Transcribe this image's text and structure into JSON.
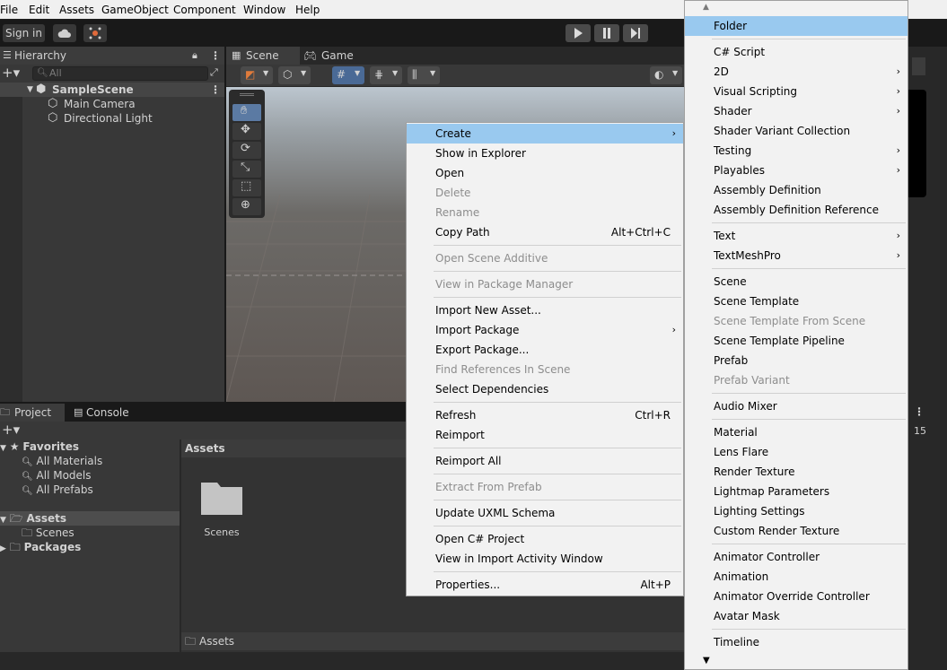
{
  "menubar": {
    "items": [
      "File",
      "Edit",
      "Assets",
      "GameObject",
      "Component",
      "Window",
      "Help"
    ]
  },
  "toolbar": {
    "sign_in": "Sign in"
  },
  "hierarchy": {
    "tab_label": "Hierarchy",
    "search_placeholder": "All",
    "scene_name": "SampleScene",
    "objects": [
      "Main Camera",
      "Directional Light"
    ]
  },
  "scene_view": {
    "tabs": [
      "Scene",
      "Game"
    ]
  },
  "project": {
    "tabs": [
      "Project",
      "Console"
    ],
    "favorites_label": "Favorites",
    "favorites": [
      "All Materials",
      "All Models",
      "All Prefabs"
    ],
    "assets_label": "Assets",
    "assets_children": [
      "Scenes"
    ],
    "packages_label": "Packages",
    "grid_header": "Assets",
    "grid_items": [
      "Scenes"
    ],
    "status_path": "Assets",
    "count_badge": "15"
  },
  "context_menu": {
    "items": [
      {
        "label": "Create",
        "submenu": true,
        "highlighted": true
      },
      {
        "label": "Show in Explorer"
      },
      {
        "label": "Open"
      },
      {
        "label": "Delete",
        "disabled": true
      },
      {
        "label": "Rename",
        "disabled": true
      },
      {
        "label": "Copy Path",
        "shortcut": "Alt+Ctrl+C"
      },
      {
        "label": "Open Scene Additive",
        "disabled": true
      },
      {
        "label": "View in Package Manager",
        "disabled": true
      },
      {
        "label": "Import New Asset..."
      },
      {
        "label": "Import Package",
        "submenu": true
      },
      {
        "label": "Export Package..."
      },
      {
        "label": "Find References In Scene",
        "disabled": true
      },
      {
        "label": "Select Dependencies"
      },
      {
        "label": "Refresh",
        "shortcut": "Ctrl+R"
      },
      {
        "label": "Reimport"
      },
      {
        "label": "Reimport All"
      },
      {
        "label": "Extract From Prefab",
        "disabled": true
      },
      {
        "label": "Update UXML Schema"
      },
      {
        "label": "Open C# Project"
      },
      {
        "label": "View in Import Activity Window"
      },
      {
        "label": "Properties...",
        "shortcut": "Alt+P"
      }
    ]
  },
  "create_menu": {
    "items": [
      {
        "label": "Folder",
        "highlighted": true
      },
      {
        "label": "C# Script"
      },
      {
        "label": "2D",
        "submenu": true
      },
      {
        "label": "Visual Scripting",
        "submenu": true
      },
      {
        "label": "Shader",
        "submenu": true
      },
      {
        "label": "Shader Variant Collection"
      },
      {
        "label": "Testing",
        "submenu": true
      },
      {
        "label": "Playables",
        "submenu": true
      },
      {
        "label": "Assembly Definition"
      },
      {
        "label": "Assembly Definition Reference"
      },
      {
        "label": "Text",
        "submenu": true
      },
      {
        "label": "TextMeshPro",
        "submenu": true
      },
      {
        "label": "Scene"
      },
      {
        "label": "Scene Template"
      },
      {
        "label": "Scene Template From Scene",
        "disabled": true
      },
      {
        "label": "Scene Template Pipeline"
      },
      {
        "label": "Prefab"
      },
      {
        "label": "Prefab Variant",
        "disabled": true
      },
      {
        "label": "Audio Mixer"
      },
      {
        "label": "Material"
      },
      {
        "label": "Lens Flare"
      },
      {
        "label": "Render Texture"
      },
      {
        "label": "Lightmap Parameters"
      },
      {
        "label": "Lighting Settings"
      },
      {
        "label": "Custom Render Texture"
      },
      {
        "label": "Animator Controller"
      },
      {
        "label": "Animation"
      },
      {
        "label": "Animator Override Controller"
      },
      {
        "label": "Avatar Mask"
      },
      {
        "label": "Timeline"
      }
    ]
  },
  "colors": {
    "menu_highlight": "#99c9ef",
    "editor_dark": "#383838",
    "disabled_text": "#8d8d8d"
  }
}
